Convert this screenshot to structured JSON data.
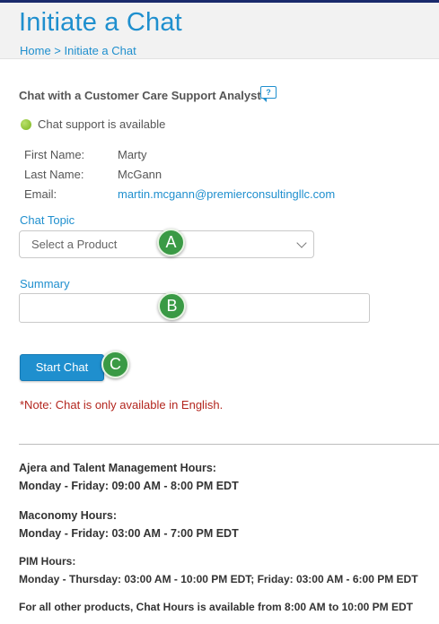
{
  "header": {
    "title": "Initiate a Chat",
    "breadcrumb_home": "Home",
    "breadcrumb_separator": " > ",
    "breadcrumb_current": "Initiate a Chat"
  },
  "chat": {
    "heading": "Chat with a Customer Care Support Analyst",
    "help_icon_text": "?",
    "status": "Chat support is available"
  },
  "user": {
    "first_name_label": "First Name:",
    "first_name": "Marty",
    "last_name_label": "Last Name:",
    "last_name": "McGann",
    "email_label": "Email:",
    "email": "martin.mcgann@premierconsultingllc.com"
  },
  "form": {
    "topic_label": "Chat Topic",
    "topic_selected": "Select a Product",
    "summary_label": "Summary",
    "summary_value": "",
    "start_button": "Start Chat"
  },
  "callouts": {
    "a": "A",
    "b": "B",
    "c": "C"
  },
  "note": "*Note: Chat is only available in English.",
  "hours": [
    {
      "title": "Ajera and Talent Management Hours:",
      "schedule": "Monday - Friday: 09:00 AM - 8:00 PM EDT"
    },
    {
      "title": "Maconomy Hours:",
      "schedule": "Monday - Friday: 03:00 AM - 7:00 PM EDT"
    },
    {
      "title": "PIM Hours:",
      "schedule": "Monday - Thursday: 03:00 AM - 10:00 PM EDT; Friday: 03:00 AM - 6:00 PM EDT"
    }
  ],
  "other_products": "For all other products, Chat Hours is available from 8:00 AM to 10:00 PM EDT",
  "colors": {
    "accent": "#1f8fce",
    "callout": "#3a9a45",
    "note": "#b3261e",
    "status": "#7ab51d"
  },
  "icons": {
    "status": "status-available-icon",
    "help": "chat-help-icon",
    "dropdown": "chevron-down-icon"
  }
}
